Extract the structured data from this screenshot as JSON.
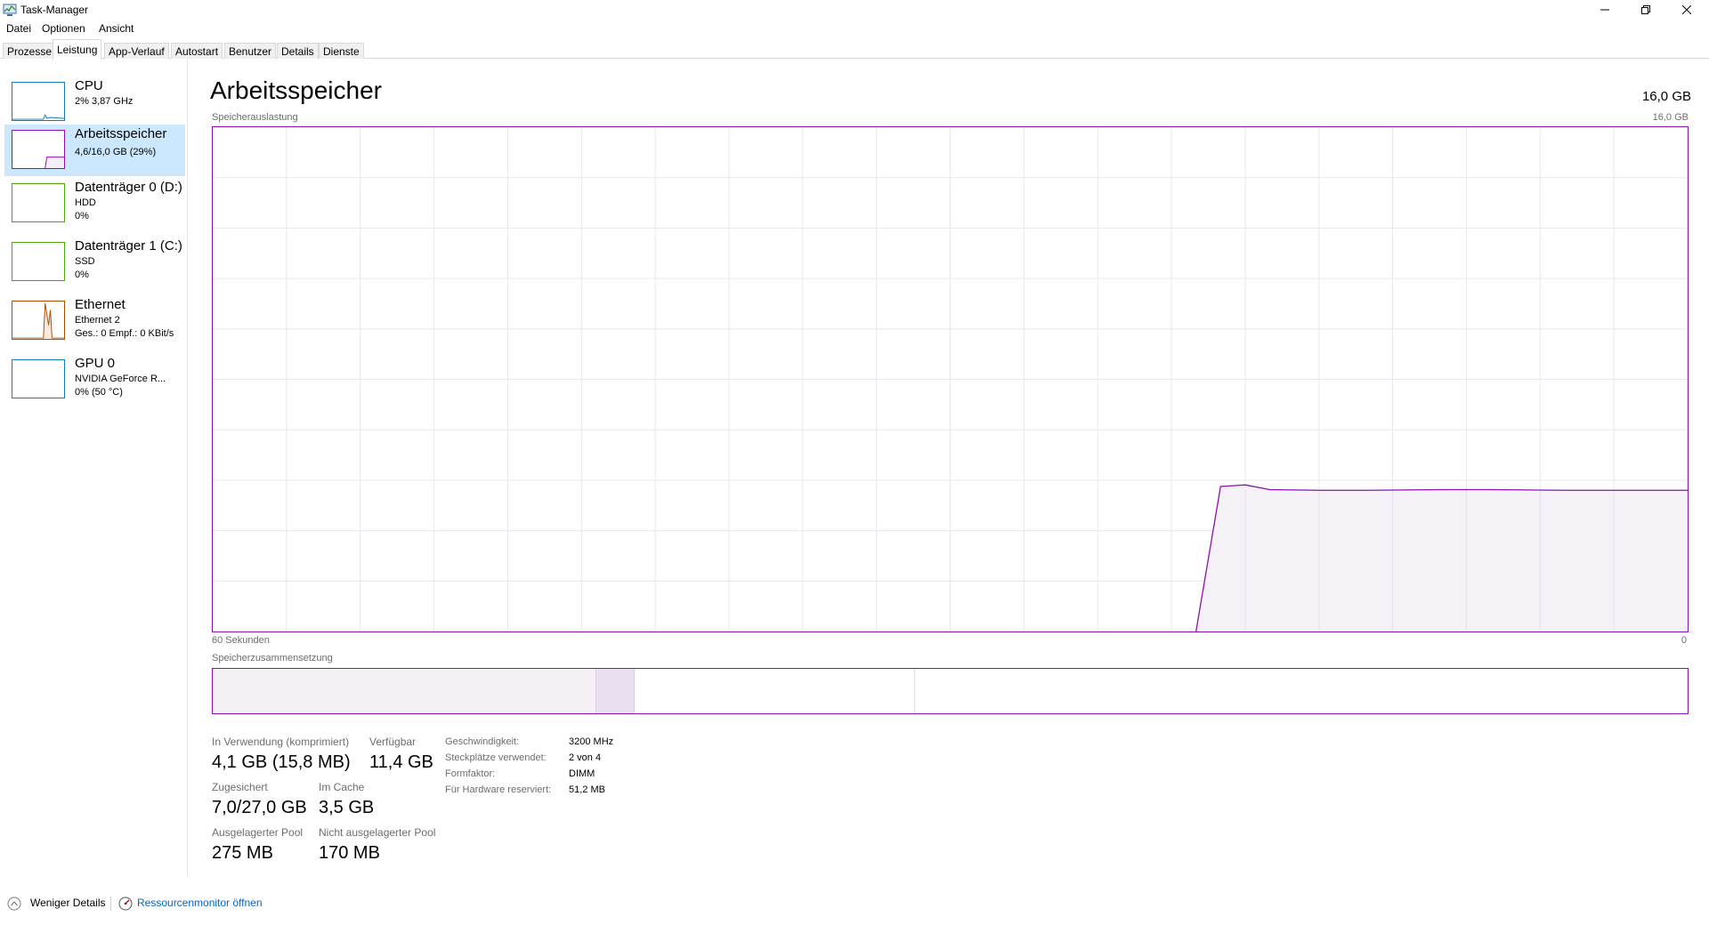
{
  "window": {
    "title": "Task-Manager",
    "icons": {
      "app": "task-manager-icon",
      "minimize": "minimize-icon",
      "restore": "restore-icon",
      "close": "close-icon"
    }
  },
  "menu": {
    "items": [
      "Datei",
      "Optionen",
      "Ansicht"
    ]
  },
  "tabs": [
    "Prozesse",
    "Leistung",
    "App-Verlauf",
    "Autostart",
    "Benutzer",
    "Details",
    "Dienste"
  ],
  "active_tab": "Leistung",
  "sidebar": {
    "items": [
      {
        "title": "CPU",
        "line1": "2%  3,87 GHz",
        "line2": "",
        "color": "#117dbb"
      },
      {
        "title": "Arbeitsspeicher",
        "line1": "4,6/16,0 GB (29%)",
        "line2": "",
        "color": "#8b12ae",
        "selected": true
      },
      {
        "title": "Datenträger 0 (D:)",
        "line1": "HDD",
        "line2": "0%",
        "color": "#4da60c"
      },
      {
        "title": "Datenträger 1 (C:)",
        "line1": "SSD",
        "line2": "0%",
        "color": "#4da60c"
      },
      {
        "title": "Ethernet",
        "line1": "Ethernet 2",
        "line2": "Ges.: 0  Empf.: 0 KBit/s",
        "color": "#a74f01"
      },
      {
        "title": "GPU 0",
        "line1": "NVIDIA GeForce R...",
        "line2": "0% (50 °C)",
        "color": "#117dbb"
      }
    ]
  },
  "main": {
    "title": "Arbeitsspeicher",
    "capacity": "16,0 GB",
    "graph_label": "Speicherauslastung",
    "graph_max": "16,0 GB",
    "graph_time_left": "60 Sekunden",
    "graph_time_right": "0",
    "composition_label": "Speicherzusammensetzung"
  },
  "stats": {
    "in_use_label": "In Verwendung (komprimiert)",
    "in_use_value": "4,1 GB (15,8 MB)",
    "available_label": "Verfügbar",
    "available_value": "11,4 GB",
    "committed_label": "Zugesichert",
    "committed_value": "7,0/27,0 GB",
    "cached_label": "Im Cache",
    "cached_value": "3,5 GB",
    "paged_label": "Ausgelagerter Pool",
    "paged_value": "275 MB",
    "nonpaged_label": "Nicht ausgelagerter Pool",
    "nonpaged_value": "170 MB"
  },
  "specs": [
    {
      "label": "Geschwindigkeit:",
      "value": "3200 MHz"
    },
    {
      "label": "Steckplätze verwendet:",
      "value": "2 von 4"
    },
    {
      "label": "Formfaktor:",
      "value": "DIMM"
    },
    {
      "label": "Für Hardware reserviert:",
      "value": "51,2 MB"
    }
  ],
  "footer": {
    "less_details": "Weniger Details",
    "resource_monitor": "Ressourcenmonitor öffnen"
  },
  "chart_data": {
    "type": "area",
    "title": "Speicherauslastung",
    "xlabel": "60 Sekunden",
    "ylabel": "",
    "xlim": [
      60,
      0
    ],
    "ylim": [
      0,
      16.0
    ],
    "x": [
      20,
      19,
      18,
      17,
      15,
      13,
      10,
      8,
      5,
      3,
      0
    ],
    "series": [
      {
        "values": [
          0.0,
          4.6,
          4.65,
          4.5,
          4.48,
          4.48,
          4.5,
          4.5,
          4.48,
          4.48,
          4.48
        ]
      }
    ],
    "composition": {
      "in_use_fraction": 0.26,
      "modified_fraction": 0.026,
      "standby_fraction": 0.19,
      "free_fraction": 0.524
    }
  }
}
